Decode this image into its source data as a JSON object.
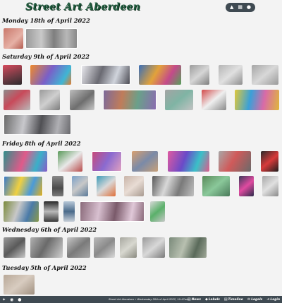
{
  "header": {
    "title": "Street Art Aberdeen",
    "icons": [
      "map-icon",
      "gallery-icon",
      "info-icon"
    ]
  },
  "days": [
    {
      "label": "Monday 18th of April 2022"
    },
    {
      "label": "Saturday 9th of April 2022"
    },
    {
      "label": "Friday 8th of April 2022"
    },
    {
      "label": "Wednesday 6th of April 2022"
    },
    {
      "label": "Tuesday 5th of April 2022"
    }
  ],
  "footer": {
    "social_icons": [
      "twitter-icon",
      "instagram-icon",
      "github-icon"
    ],
    "credit": "Street Art Aberdeen • Wednesday 20th of April 2022, 10:47am",
    "nav": [
      {
        "icon": "news-icon",
        "label": "News"
      },
      {
        "icon": "labels-icon",
        "label": "Labels"
      },
      {
        "icon": "timeline-icon",
        "label": "Timeline"
      },
      {
        "icon": "legals-icon",
        "label": "Legals"
      },
      {
        "icon": "login-icon",
        "label": "Login"
      }
    ]
  },
  "colors": {
    "title": "#1e5a3c",
    "bar": "#3f4a52",
    "background": "#f3f3f3"
  }
}
